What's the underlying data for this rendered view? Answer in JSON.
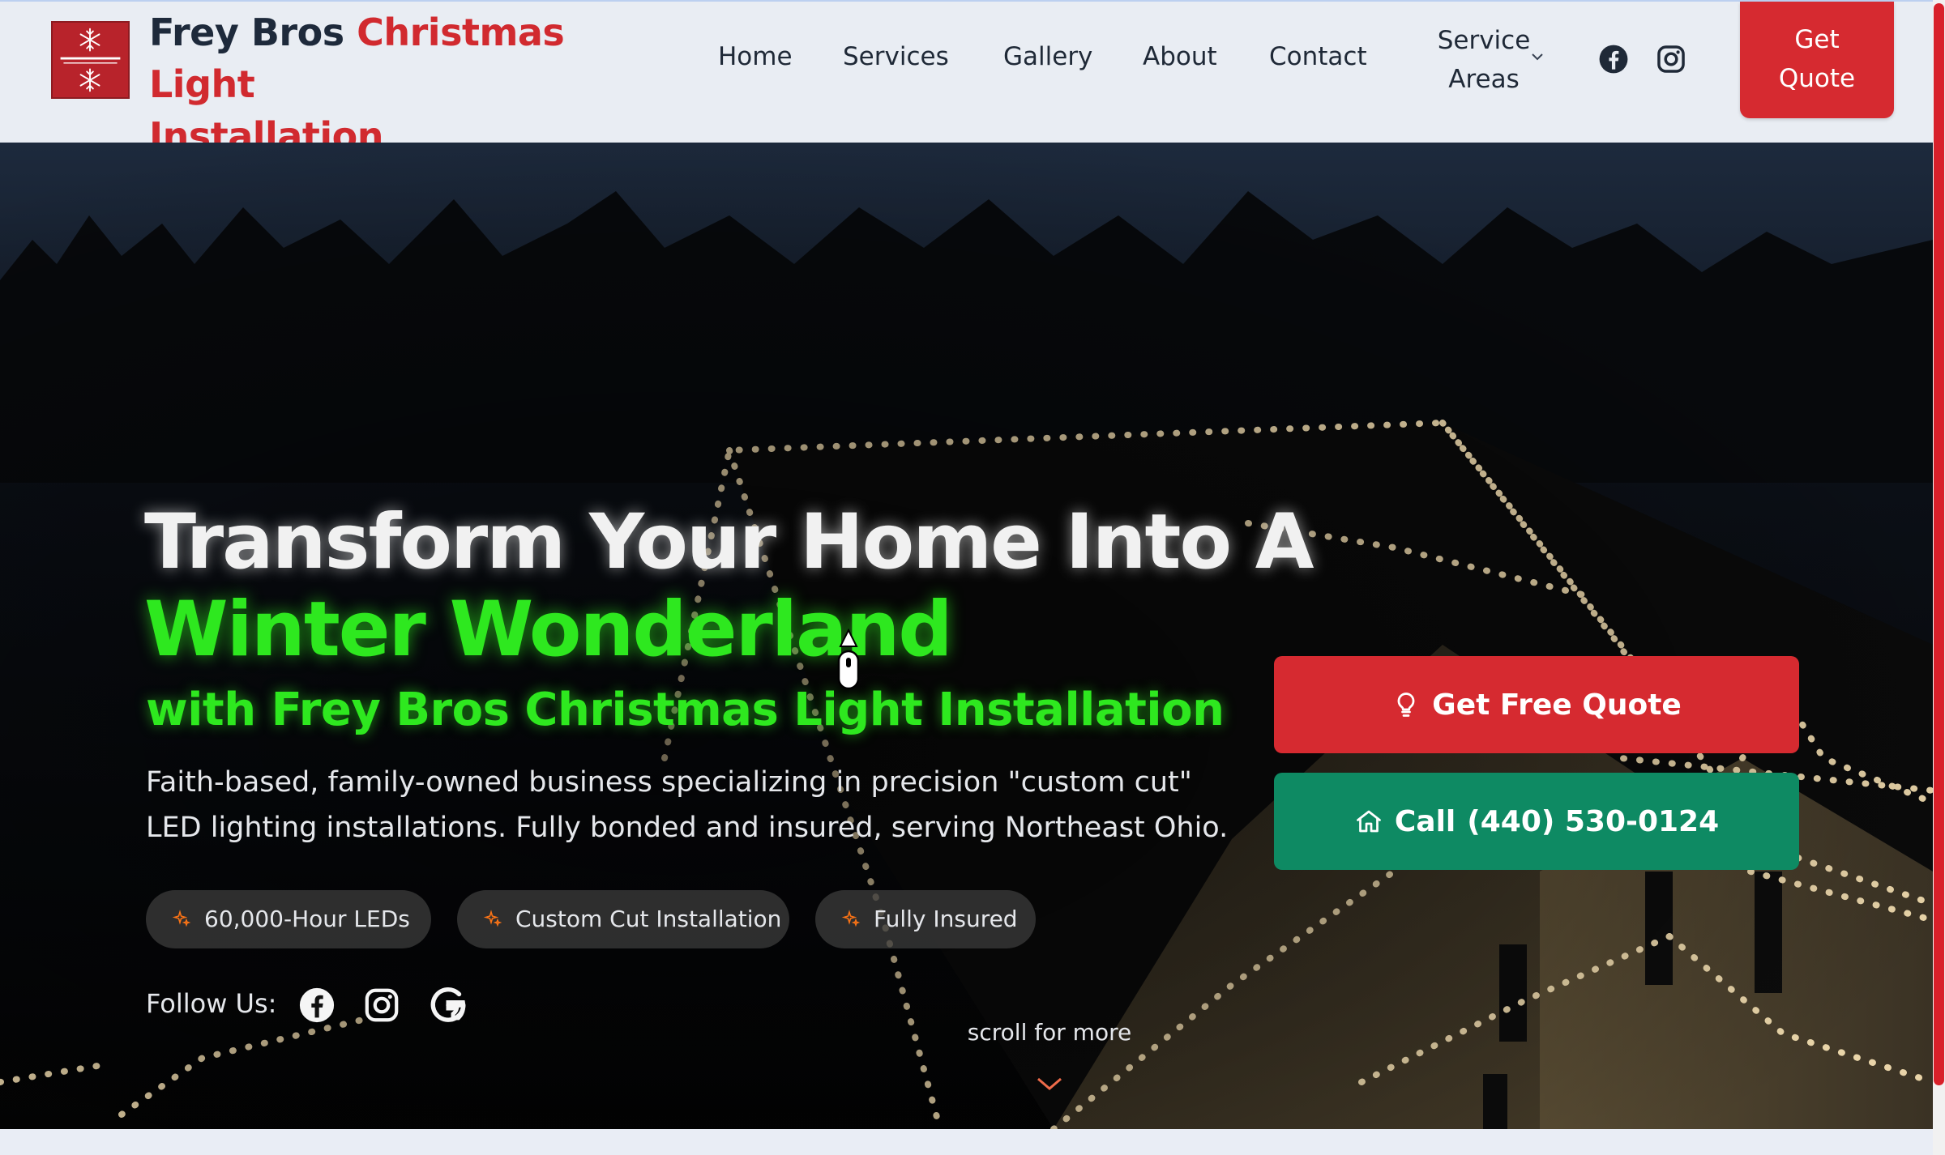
{
  "header": {
    "brand_part1": "Frey Bros",
    "brand_part2": "Christmas Light",
    "brand_part3": "Installation",
    "logo_icon": "snowflake-logo",
    "nav": [
      {
        "label": "Home"
      },
      {
        "label": "Services"
      },
      {
        "label": "Gallery"
      },
      {
        "label": "About"
      },
      {
        "label": "Contact"
      }
    ],
    "service_areas_line1": "Service",
    "service_areas_line2": "Areas",
    "social_icons": [
      "facebook-icon",
      "instagram-icon"
    ],
    "get_quote_line1": "Get",
    "get_quote_line2": "Quote"
  },
  "hero": {
    "headline_1": "Transform Your Home Into A",
    "headline_2": "Winter Wonderland",
    "headline_3": "with Frey Bros Christmas Light Installation",
    "subtext": "Faith-based, family-owned business specializing in precision \"custom cut\" LED lighting installations. Fully bonded and insured, serving Northeast Ohio.",
    "features": [
      {
        "label": "60,000-Hour LEDs",
        "icon": "sparkle-icon"
      },
      {
        "label": "Custom Cut Installation",
        "icon": "sparkle-icon"
      },
      {
        "label": "Fully Insured",
        "icon": "sparkle-icon"
      }
    ],
    "follow_label": "Follow Us:",
    "follow_icons": [
      "facebook-icon",
      "instagram-icon",
      "google-icon"
    ],
    "scroll_label": "scroll for more",
    "cta_quote_label": "Get Free Quote",
    "cta_call_label": "Call",
    "cta_call_number": "(440) 530-0124"
  },
  "colors": {
    "brand_red": "#d62a30",
    "brand_navy": "#1e2a3b",
    "glow_green": "#2ee81f",
    "call_green": "#0e8a63"
  }
}
